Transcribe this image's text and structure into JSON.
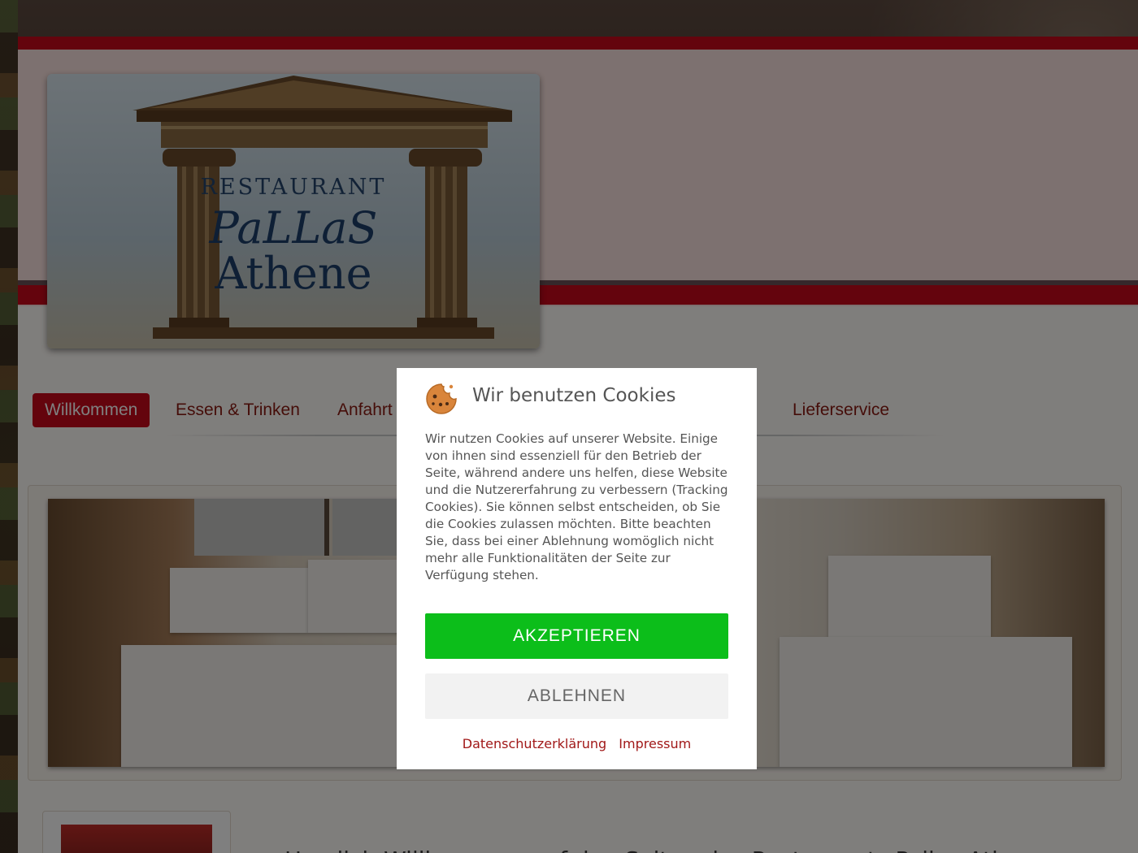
{
  "logo": {
    "line1": "RESTAURANT",
    "line2": "PaLLaS",
    "line3": "Athene"
  },
  "nav": {
    "items": [
      {
        "label": "Willkommen",
        "active": true
      },
      {
        "label": "Essen & Trinken",
        "active": false
      },
      {
        "label": "Anfahrt",
        "active": false
      },
      {
        "label": "Lieferservice",
        "active": false
      }
    ]
  },
  "content": {
    "welcome_title": "Herzlich Willkommen auf den Seiten des Restaurants Pallas Athene"
  },
  "cookie_dialog": {
    "icon": "cookie-icon",
    "title": "Wir benutzen Cookies",
    "text": "Wir nutzen Cookies auf unserer Website. Einige von ihnen sind essenziell für den Betrieb der Seite, während andere uns helfen, diese Website und die Nutzererfahrung zu verbessern (Tracking Cookies). Sie können selbst entscheiden, ob Sie die Cookies zulassen möchten. Bitte beachten Sie, dass bei einer Ablehnung womöglich nicht mehr alle Funktionalitäten der Seite zur Verfügung stehen.",
    "accept_label": "AKZEPTIEREN",
    "decline_label": "ABLEHNEN",
    "privacy_link": "Datenschutzerklärung",
    "imprint_link": "Impressum"
  },
  "colors": {
    "brand_red": "#c8081a",
    "accept_green": "#0cbe1a",
    "link_red": "#a11818",
    "header_pink": "#fbe3e0"
  }
}
